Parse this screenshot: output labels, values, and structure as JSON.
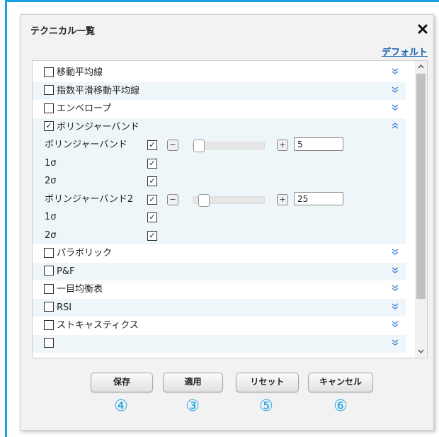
{
  "dialog": {
    "title": "テクニカル一覧",
    "close_glyph": "✕",
    "default_link": "デフォルト"
  },
  "indicators": [
    {
      "label": "移動平均線",
      "checked": false,
      "expand": "»"
    },
    {
      "label": "指数平滑移動平均線",
      "checked": false,
      "expand": "»"
    },
    {
      "label": "エンベロープ",
      "checked": false,
      "expand": "»"
    },
    {
      "label": "ボリンジャーバンド",
      "checked": true,
      "expand": "«"
    }
  ],
  "bollinger": {
    "band1": {
      "label": "ボリンジャーバンド",
      "checked": true,
      "value": "5",
      "minus": "−",
      "plus": "+",
      "slider_fraction": 0.0
    },
    "band1_sigma1": {
      "label": "1σ",
      "checked": true
    },
    "band1_sigma2": {
      "label": "2σ",
      "checked": true
    },
    "band2": {
      "label": "ボリンジャーバンド2",
      "checked": true,
      "value": "25",
      "minus": "−",
      "plus": "+",
      "slider_fraction": 0.08
    },
    "band2_sigma1": {
      "label": "1σ",
      "checked": true
    },
    "band2_sigma2": {
      "label": "2σ",
      "checked": true
    }
  },
  "indicators_after": [
    {
      "label": "パラボリック",
      "checked": false,
      "expand": "»"
    },
    {
      "label": "P&F",
      "checked": false,
      "expand": "»"
    },
    {
      "label": "一目均衡表",
      "checked": false,
      "expand": "»"
    },
    {
      "label": "RSI",
      "checked": false,
      "expand": "»"
    },
    {
      "label": "ストキャスティクス",
      "checked": false,
      "expand": "»"
    }
  ],
  "buttons": {
    "save": "保存",
    "apply": "適用",
    "reset": "リセット",
    "cancel": "キャンセル"
  },
  "annotations": {
    "save": "④",
    "apply": "③",
    "reset": "⑤",
    "cancel": "⑥"
  },
  "check_glyph": "✓",
  "scrollbar": {
    "up": "▲",
    "down": "▼"
  }
}
